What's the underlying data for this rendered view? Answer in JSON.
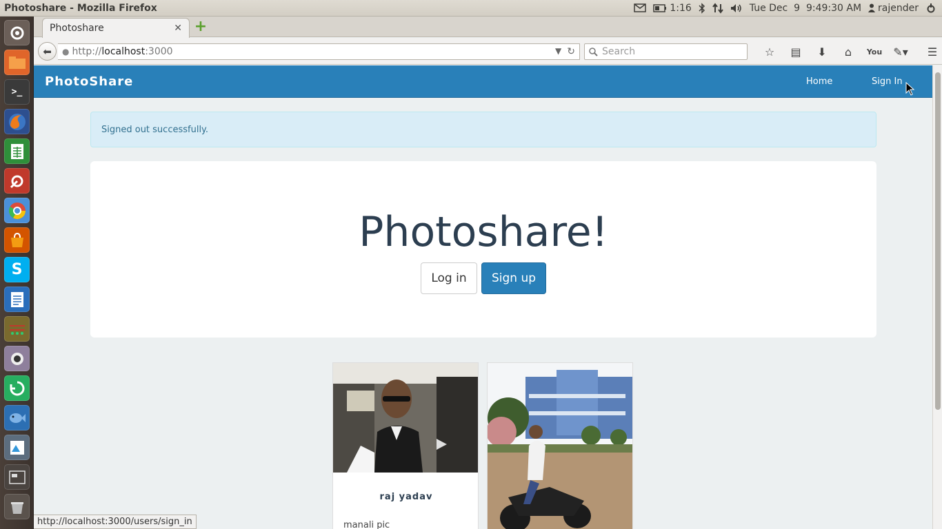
{
  "window": {
    "title": "Photoshare - Mozilla Firefox"
  },
  "panel": {
    "battery_time": "1:16",
    "datetime": "Tue Dec  9  9:49:30 AM",
    "username": "rajender"
  },
  "launcher": {
    "items": [
      "dash-icon",
      "files-icon",
      "terminal-icon",
      "firefox-icon",
      "spreadsheet-icon",
      "settings-icon",
      "chrome-icon",
      "software-center-icon",
      "skype-icon",
      "writer-icon",
      "calculator-icon",
      "webcam-icon",
      "recycle-icon",
      "fish-icon",
      "image-viewer-icon",
      "workspace-icon",
      "trash-icon"
    ]
  },
  "browser": {
    "tab_title": "Photoshare",
    "url_prefix": "http://",
    "url_host": "localhost",
    "url_port": ":3000",
    "search_placeholder": "Search",
    "status_url": "http://localhost:3000/users/sign_in"
  },
  "site": {
    "brand": "PhotoShare",
    "nav": {
      "home": "Home",
      "sign_in": "Sign In"
    },
    "alert": "Signed out successfully.",
    "heading": "Photoshare!",
    "login_label": "Log in",
    "signup_label": "Sign up",
    "accent_color": "#2980b9",
    "cards": [
      {
        "name": "raj yadav",
        "description": "manali pic"
      },
      {
        "name": "",
        "description": ""
      }
    ]
  }
}
